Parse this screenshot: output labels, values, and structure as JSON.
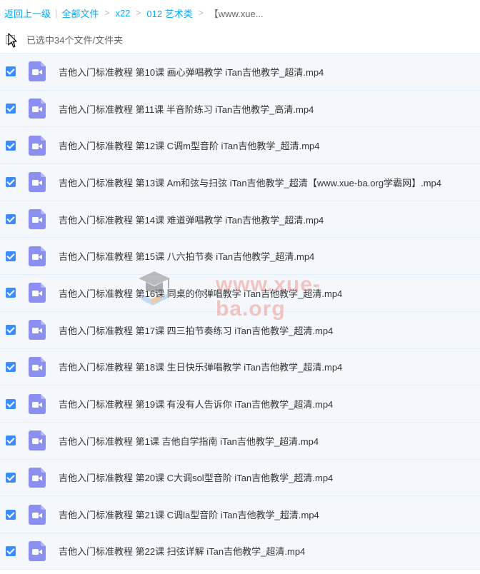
{
  "breadcrumb": {
    "back": "返回上一级",
    "all_files": "全部文件",
    "sep": ">",
    "sep_bar": "|",
    "folder1": "x22",
    "folder2": "012 艺术类",
    "current": "【www.xue..."
  },
  "selection": {
    "status": "已选中34个文件/文件夹"
  },
  "files": [
    {
      "name": "吉他入门标准教程 第10课 画心弹唱教学 iTan吉他教学_超清.mp4",
      "checked": true
    },
    {
      "name": "吉他入门标准教程 第11课 半音阶练习 iTan吉他教学_高清.mp4",
      "checked": true
    },
    {
      "name": "吉他入门标准教程 第12课 C调m型音阶 iTan吉他教学_超清.mp4",
      "checked": true
    },
    {
      "name": "吉他入门标准教程 第13课 Am和弦与扫弦 iTan吉他教学_超清【www.xue-ba.org学霸网】.mp4",
      "checked": true
    },
    {
      "name": "吉他入门标准教程 第14课 难道弹唱教学 iTan吉他教学_超清.mp4",
      "checked": true
    },
    {
      "name": "吉他入门标准教程 第15课 八六拍节奏 iTan吉他教学_超清.mp4",
      "checked": true
    },
    {
      "name": "吉他入门标准教程 第16课 同桌的你弹唱教学 iTan吉他教学_超清.mp4",
      "checked": true
    },
    {
      "name": "吉他入门标准教程 第17课 四三拍节奏练习 iTan吉他教学_超清.mp4",
      "checked": true
    },
    {
      "name": "吉他入门标准教程 第18课 生日快乐弹唱教学 iTan吉他教学_超清.mp4",
      "checked": true
    },
    {
      "name": "吉他入门标准教程 第19课 有没有人告诉你 iTan吉他教学_超清.mp4",
      "checked": true
    },
    {
      "name": "吉他入门标准教程 第1课 吉他自学指南 iTan吉他教学_超清.mp4",
      "checked": true
    },
    {
      "name": "吉他入门标准教程 第20课 C大调sol型音阶 iTan吉他教学_超清.mp4",
      "checked": true
    },
    {
      "name": "吉他入门标准教程 第21课 C调la型音阶 iTan吉他教学_超清.mp4",
      "checked": true
    },
    {
      "name": "吉他入门标准教程 第22课 扫弦详解 iTan吉他教学_超清.mp4",
      "checked": true
    }
  ],
  "icons": {
    "file": "video-file-icon",
    "cursor": "mouse-cursor-icon",
    "watermark": "graduation-cap-icon"
  },
  "watermark": {
    "text": "www.xue-ba.org"
  },
  "colors": {
    "accent": "#3b8cff",
    "link": "#09aaff",
    "video_icon": "#8b8ff0",
    "row_bg": "#f4f8fd"
  }
}
